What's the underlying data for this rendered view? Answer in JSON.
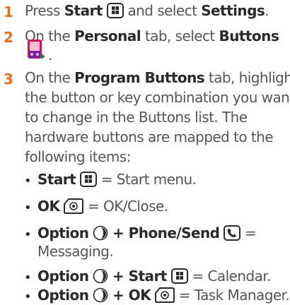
{
  "steps": [
    {
      "number": "1",
      "parts": [
        "Press ",
        "Start",
        " and select ",
        "Settings",
        "."
      ]
    },
    {
      "number": "2",
      "parts": [
        "On the ",
        "Personal",
        " tab, select ",
        "Buttons",
        "."
      ]
    },
    {
      "number": "3",
      "lines": [
        [
          "On the ",
          "Program Buttons",
          " tab, highlight"
        ],
        "the button or key combination you want",
        "to change in the Buttons list. The",
        "hardware buttons are mapped to the",
        "following items:"
      ]
    }
  ],
  "bullets": [
    {
      "key": "Start",
      "value": "= Start menu."
    },
    {
      "key": "OK",
      "value": "= OK/Close."
    },
    {
      "key1": "Option",
      "key2": "+ Phone/Send",
      "value": "=",
      "value2": "Messaging."
    },
    {
      "key1": "Option",
      "key2": "+ Start",
      "value": "= Calendar."
    },
    {
      "key1": "Option",
      "key2": "+ OK",
      "value": "= Task Manager."
    }
  ],
  "colors": {
    "accent": "#eb6e1f",
    "text": "#555555",
    "bold": "#2a2a2a"
  },
  "icons": [
    "windows-start-key-icon",
    "buttons-settings-app-icon",
    "ok-key-icon",
    "option-key-icon",
    "phone-send-key-icon"
  ]
}
